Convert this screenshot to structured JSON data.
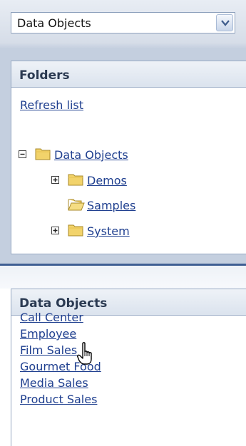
{
  "dropdown": {
    "selected": "Data Objects"
  },
  "folders_panel": {
    "title": "Folders",
    "refresh_label": "Refresh list",
    "tree": [
      {
        "label": "Data Objects",
        "expander": "minus",
        "folder": "closed"
      },
      {
        "label": "Demos",
        "expander": "plus",
        "folder": "closed"
      },
      {
        "label": "Samples",
        "expander": "none",
        "folder": "open"
      },
      {
        "label": "System",
        "expander": "plus",
        "folder": "closed"
      }
    ]
  },
  "data_objects_panel": {
    "title": "Data Objects",
    "items": [
      "Call Center",
      "Employee",
      "Film Sales",
      "Gourmet Food",
      "Media Sales",
      "Product Sales"
    ]
  },
  "colors": {
    "link": "#1f3f8f",
    "header_text": "#2b3a52",
    "divider": "#3f5f93",
    "folder": "#f2d36b"
  },
  "icons": {
    "cursor": "hand-pointer-icon",
    "dropdown_arrow": "chevron-down-icon"
  }
}
